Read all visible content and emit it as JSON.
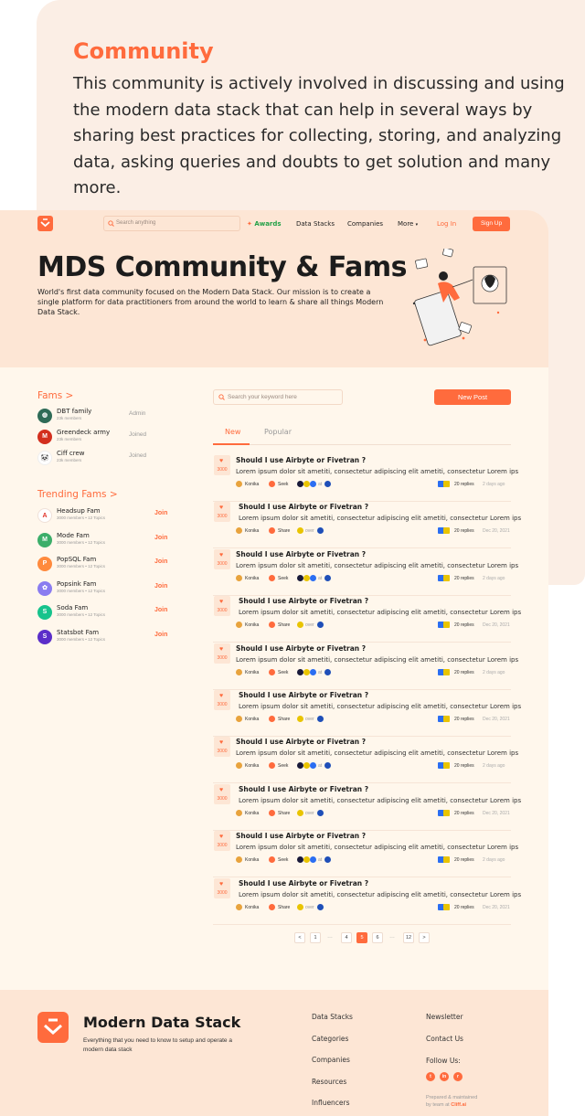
{
  "intro": {
    "title": "Community",
    "text": "This community is actively involved in discussing and using the modern data stack that can help in several ways by sharing best practices for collecting, storing, and analyzing data, asking queries and doubts to get solution and many more."
  },
  "nav": {
    "search_placeholder": "Search anything",
    "awards": "Awards",
    "data_stacks": "Data Stacks",
    "companies": "Companies",
    "more": "More",
    "login": "Log In",
    "signup": "Sign Up"
  },
  "hero": {
    "title": "MDS Community & Fams",
    "description": "World's first data community focused on the Modern Data Stack. Our mission is to create a single platform for data practitioners from around the world to learn & share all things Modern Data Stack."
  },
  "fams": {
    "title": "Fams >",
    "items": [
      {
        "name": "DBT family",
        "members": "23k members",
        "state": "Admin",
        "color": "#2e6b57",
        "glyph": "◍"
      },
      {
        "name": "Greendeck army",
        "members": "23k members",
        "state": "Joined",
        "color": "#d32f1e",
        "glyph": "M"
      },
      {
        "name": "Ciff crew",
        "members": "23k members",
        "state": "Joined",
        "color": "#ffffff",
        "glyph": "🐼"
      }
    ]
  },
  "trending": {
    "title": "Trending Fams >",
    "join_label": "Join",
    "items": [
      {
        "name": "Headsup Fam",
        "sub": "3000 members • 12 Topics",
        "color": "#ffffff",
        "glyph": "A"
      },
      {
        "name": "Mode Fam",
        "sub": "3000 members • 12 Topics",
        "color": "#3cae6a",
        "glyph": "M"
      },
      {
        "name": "PopSQL Fam",
        "sub": "3000 members • 12 Topics",
        "color": "#ff8a3d",
        "glyph": "P"
      },
      {
        "name": "Popsink Fam",
        "sub": "3000 members • 12 Topics",
        "color": "#8a7cf0",
        "glyph": "✿"
      },
      {
        "name": "Soda Fam",
        "sub": "3000 members • 12 Topics",
        "color": "#17c38c",
        "glyph": "S"
      },
      {
        "name": "Statsbot Fam",
        "sub": "3000 members • 12 Topics",
        "color": "#5b2ec9",
        "glyph": "S"
      }
    ]
  },
  "feed": {
    "search_placeholder": "Search your keyword here",
    "new_post": "New Post",
    "tabs": [
      "New",
      "Popular"
    ],
    "posts": [
      {
        "votes": "3000",
        "title": "Should I use Airbyte or Fivetran ?",
        "body": "Lorem ipsum dolor sit ametiti, consectetur adipiscing elit ametiti, consectetur  Lorem ips",
        "author": "Konika",
        "action": "Seek",
        "tag": "at",
        "replies": "20 replies",
        "time": "2 days ago"
      },
      {
        "votes": "3000",
        "title": "Should I use Airbyte or Fivetran ?",
        "body": "Lorem ipsum dolor sit ametiti, consectetur adipiscing elit ametiti, consectetur  Lorem ips",
        "author": "Konika",
        "action": "Share",
        "tag": "over",
        "replies": "20 replies",
        "time": "Dec 20, 2021"
      },
      {
        "votes": "3000",
        "title": "Should I use Airbyte or Fivetran ?",
        "body": "Lorem ipsum dolor sit ametiti, consectetur adipiscing elit ametiti, consectetur  Lorem ips",
        "author": "Konika",
        "action": "Seek",
        "tag": "at",
        "replies": "20 replies",
        "time": "2 days ago"
      },
      {
        "votes": "3000",
        "title": "Should I use Airbyte or Fivetran ?",
        "body": "Lorem ipsum dolor sit ametiti, consectetur adipiscing elit ametiti, consectetur  Lorem ips",
        "author": "Konika",
        "action": "Share",
        "tag": "over",
        "replies": "20 replies",
        "time": "Dec 20, 2021"
      },
      {
        "votes": "3000",
        "title": "Should I use Airbyte or Fivetran ?",
        "body": "Lorem ipsum dolor sit ametiti, consectetur adipiscing elit ametiti, consectetur  Lorem ips",
        "author": "Konika",
        "action": "Seek",
        "tag": "at",
        "replies": "20 replies",
        "time": "2 days ago"
      },
      {
        "votes": "3000",
        "title": "Should I use Airbyte or Fivetran ?",
        "body": "Lorem ipsum dolor sit ametiti, consectetur adipiscing elit ametiti, consectetur  Lorem ips",
        "author": "Konika",
        "action": "Share",
        "tag": "over",
        "replies": "20 replies",
        "time": "Dec 20, 2021"
      },
      {
        "votes": "3000",
        "title": "Should I use Airbyte or Fivetran ?",
        "body": "Lorem ipsum dolor sit ametiti, consectetur adipiscing elit ametiti, consectetur  Lorem ips",
        "author": "Konika",
        "action": "Seek",
        "tag": "at",
        "replies": "20 replies",
        "time": "2 days ago"
      },
      {
        "votes": "3000",
        "title": "Should I use Airbyte or Fivetran ?",
        "body": "Lorem ipsum dolor sit ametiti, consectetur adipiscing elit ametiti, consectetur  Lorem ips",
        "author": "Konika",
        "action": "Share",
        "tag": "over",
        "replies": "20 replies",
        "time": "Dec 20, 2021"
      },
      {
        "votes": "3000",
        "title": "Should I use Airbyte or Fivetran ?",
        "body": "Lorem ipsum dolor sit ametiti, consectetur adipiscing elit ametiti, consectetur  Lorem ips",
        "author": "Konika",
        "action": "Seek",
        "tag": "at",
        "replies": "20 replies",
        "time": "2 days ago"
      },
      {
        "votes": "3000",
        "title": "Should I use Airbyte or Fivetran ?",
        "body": "Lorem ipsum dolor sit ametiti, consectetur adipiscing elit ametiti, consectetur  Lorem ips",
        "author": "Konika",
        "action": "Share",
        "tag": "over",
        "replies": "20 replies",
        "time": "Dec 20, 2021"
      }
    ]
  },
  "pagination": {
    "prev": "<",
    "next": ">",
    "pages": [
      "1",
      "…",
      "4",
      "5",
      "6",
      "…",
      "12"
    ],
    "active": "5"
  },
  "footer": {
    "brand": "Modern Data Stack",
    "tagline": "Everything that you need to know to setup and operate a modern data stack",
    "col1": [
      "Data Stacks",
      "Categories",
      "Companies",
      "Resources",
      "Influencers"
    ],
    "col2": [
      "Newsletter",
      "Contact Us"
    ],
    "follow": "Follow Us:",
    "prepared": "Prepared & maintained",
    "by": "by team at",
    "team": "Cliff.ai"
  },
  "colors": {
    "accent": "#ff6b3d",
    "hero_bg": "#fde6d5",
    "page_bg": "#fff7ec"
  }
}
